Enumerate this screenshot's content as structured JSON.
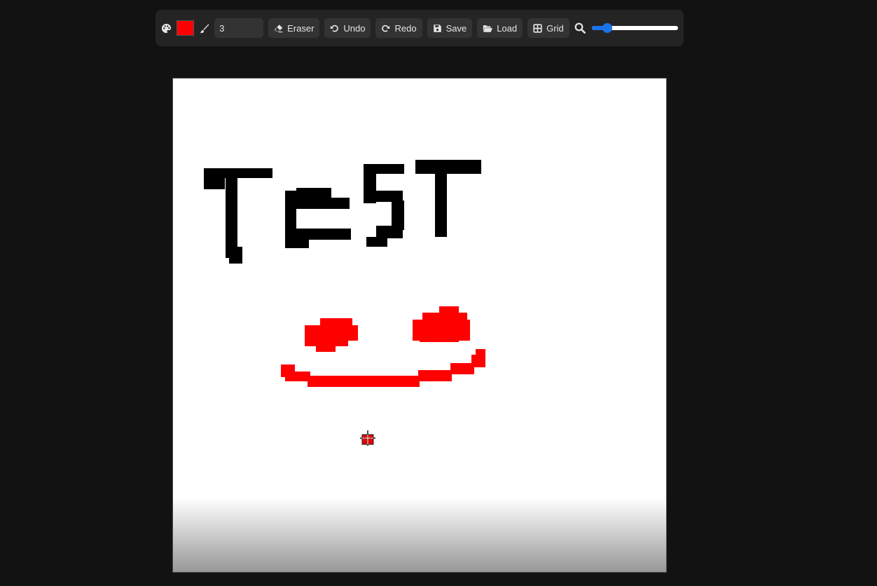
{
  "toolbar": {
    "palette_icon": "palette-icon",
    "current_color": "#ff0000",
    "brush_icon": "brush-icon",
    "brush_size": "3",
    "buttons": {
      "eraser": {
        "label": "Eraser",
        "icon": "eraser-icon"
      },
      "undo": {
        "label": "Undo",
        "icon": "undo-icon"
      },
      "redo": {
        "label": "Redo",
        "icon": "redo-icon"
      },
      "save": {
        "label": "Save",
        "icon": "save-icon"
      },
      "load": {
        "label": "Load",
        "icon": "folder-open-icon"
      },
      "grid": {
        "label": "Grid",
        "icon": "grid-icon"
      }
    },
    "zoom_icon": "magnifier-icon",
    "zoom_level": 0.18
  },
  "canvas": {
    "background": "#ffffff",
    "drawing_text": "TEST",
    "stroke_colors": {
      "text": "#000000",
      "smiley": "#ff0000"
    }
  },
  "colors": {
    "page_background": "#121212",
    "toolbar_background": "#242424",
    "accent": "#1a73e8"
  }
}
